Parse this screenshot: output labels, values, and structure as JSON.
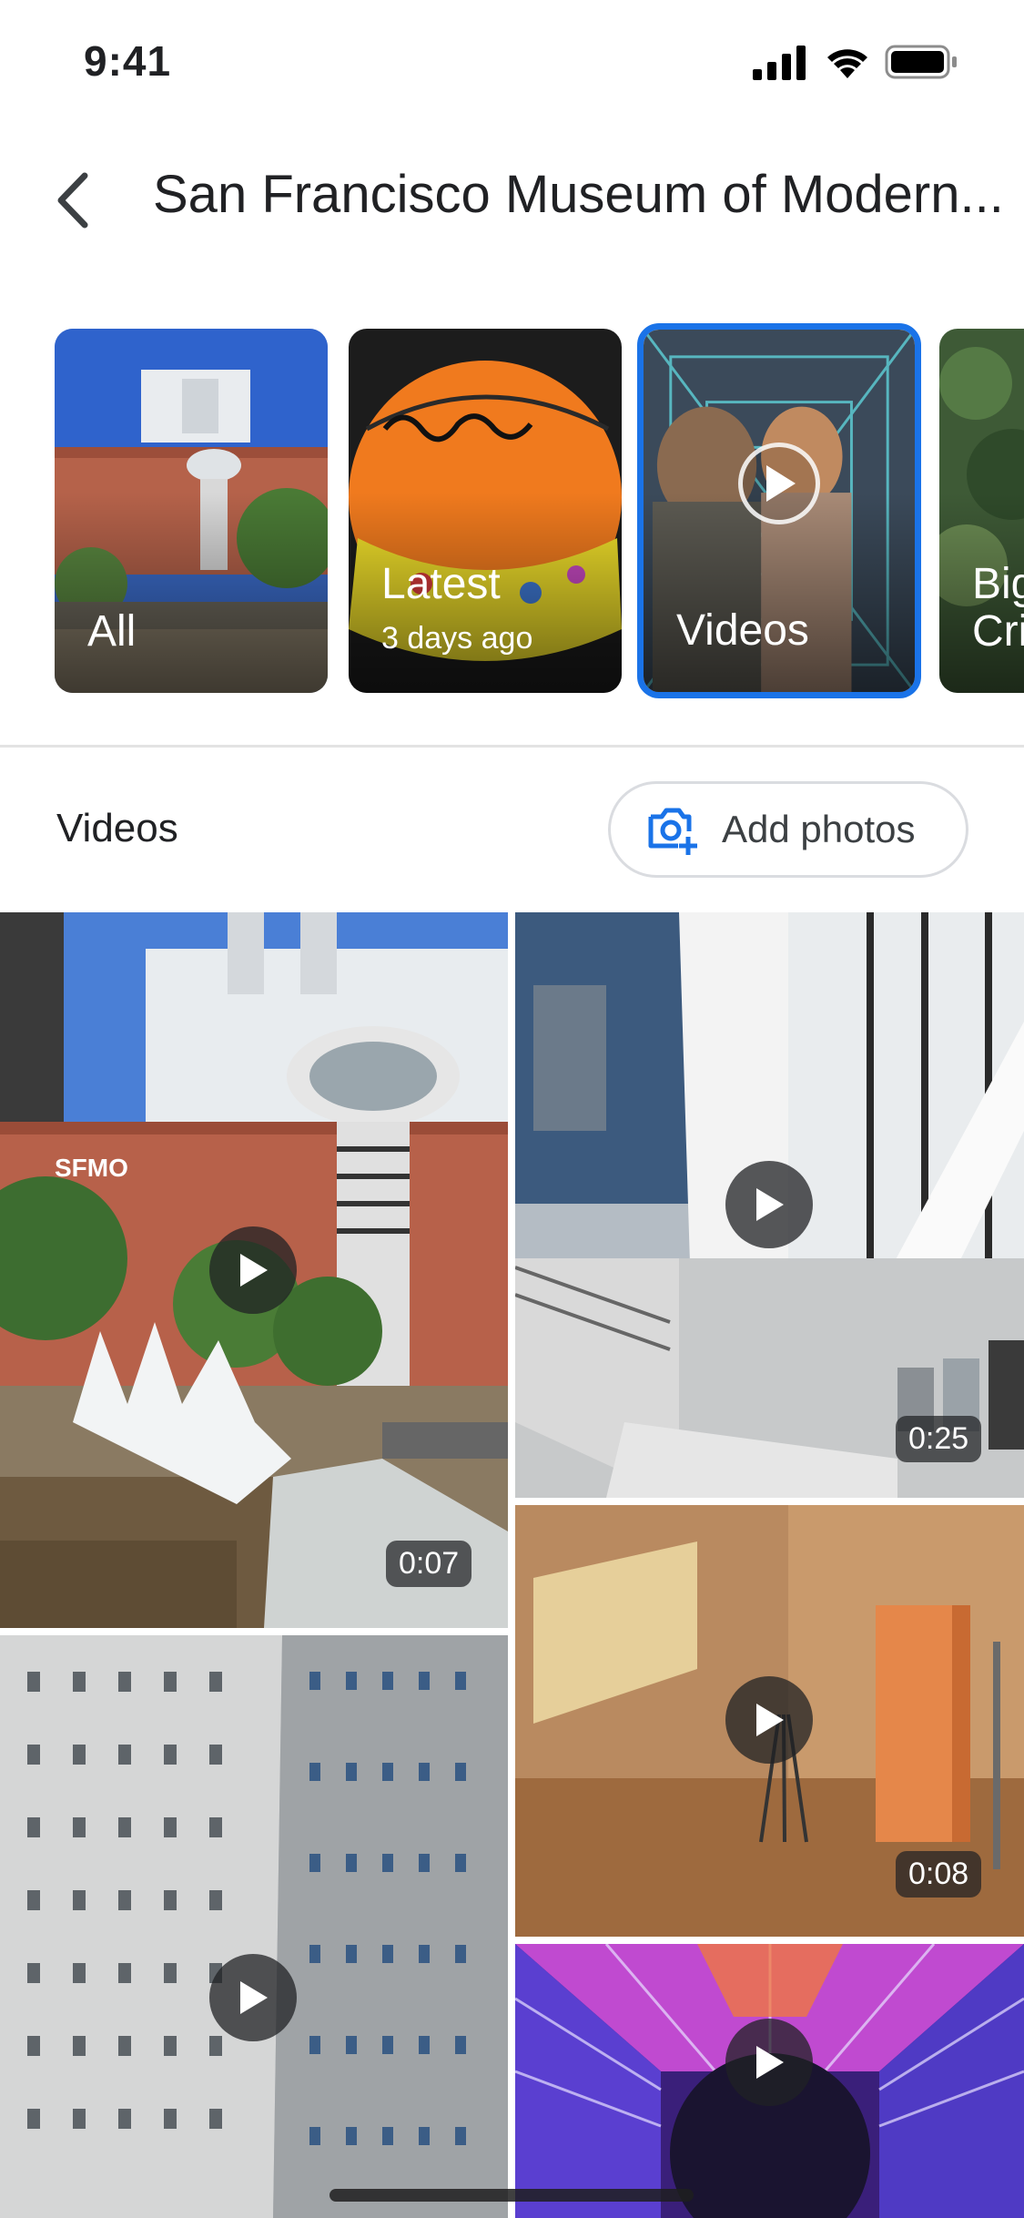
{
  "status_bar": {
    "time": "9:41"
  },
  "header": {
    "title": "San Francisco Museum of Modern..."
  },
  "categories": [
    {
      "label": "All"
    },
    {
      "label": "Latest",
      "sublabel": "3 days ago"
    },
    {
      "label": "Videos",
      "selected": true
    },
    {
      "label": "Big",
      "label_line2": "Cri"
    }
  ],
  "section": {
    "title": "Videos",
    "add_photos_label": "Add photos"
  },
  "videos": [
    {
      "duration": "0:07"
    },
    {
      "duration": "0:25"
    },
    {
      "duration": "0:08"
    },
    {
      "duration": ""
    },
    {
      "duration": ""
    }
  ],
  "colors": {
    "accent": "#1a73e8",
    "play_bg": "#202124"
  }
}
